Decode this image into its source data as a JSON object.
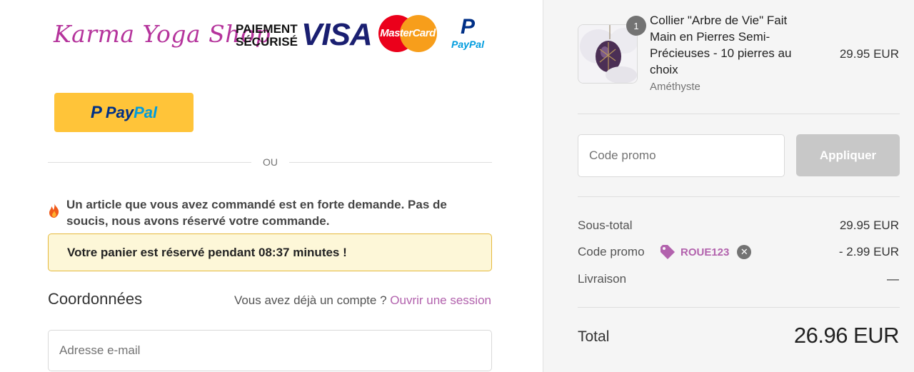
{
  "header": {
    "brand": "Karma Yoga Shop",
    "secure_line1": "PAIEMENT",
    "secure_line2": "SÉCURISÉ",
    "visa": "VISA",
    "mastercard": "MasterCard",
    "paypal_mark": "P",
    "paypal_word": "PayPal"
  },
  "express": {
    "paypal_pay": "Pay",
    "paypal_pal": "Pal",
    "paypal_p": "P",
    "divider": "OU"
  },
  "alert": {
    "icon": "fire-icon",
    "message": "Un article que vous avez commandé est en forte demande. Pas de soucis, nous avons réservé votre commande.",
    "reserved": "Votre panier est réservé pendant 08:37 minutes !"
  },
  "contact": {
    "title": "Coordonnées",
    "account_prompt": "Vous avez déjà un compte ?",
    "login_link": "Ouvrir une session",
    "email_placeholder": "Adresse e-mail",
    "email_value": ""
  },
  "summary": {
    "item": {
      "quantity": "1",
      "name": "Collier \"Arbre de Vie\" Fait Main en Pierres Semi-Précieuses - 10 pierres au choix",
      "variant": "Améthyste",
      "price": "29.95 EUR"
    },
    "promo_placeholder": "Code promo",
    "apply_label": "Appliquer",
    "subtotal_label": "Sous-total",
    "subtotal_value": "29.95 EUR",
    "discount_label": "Code promo",
    "discount_code": "ROUE123",
    "discount_value": "- 2.99 EUR",
    "shipping_label": "Livraison",
    "shipping_value": "—",
    "total_label": "Total",
    "total_value": "26.96 EUR"
  },
  "colors": {
    "brand_pink": "#b5349c",
    "link_purple": "#b262ad",
    "paypal_yellow": "#ffc439",
    "alert_bg": "#fdf7d8",
    "alert_border": "#e5b93c"
  }
}
